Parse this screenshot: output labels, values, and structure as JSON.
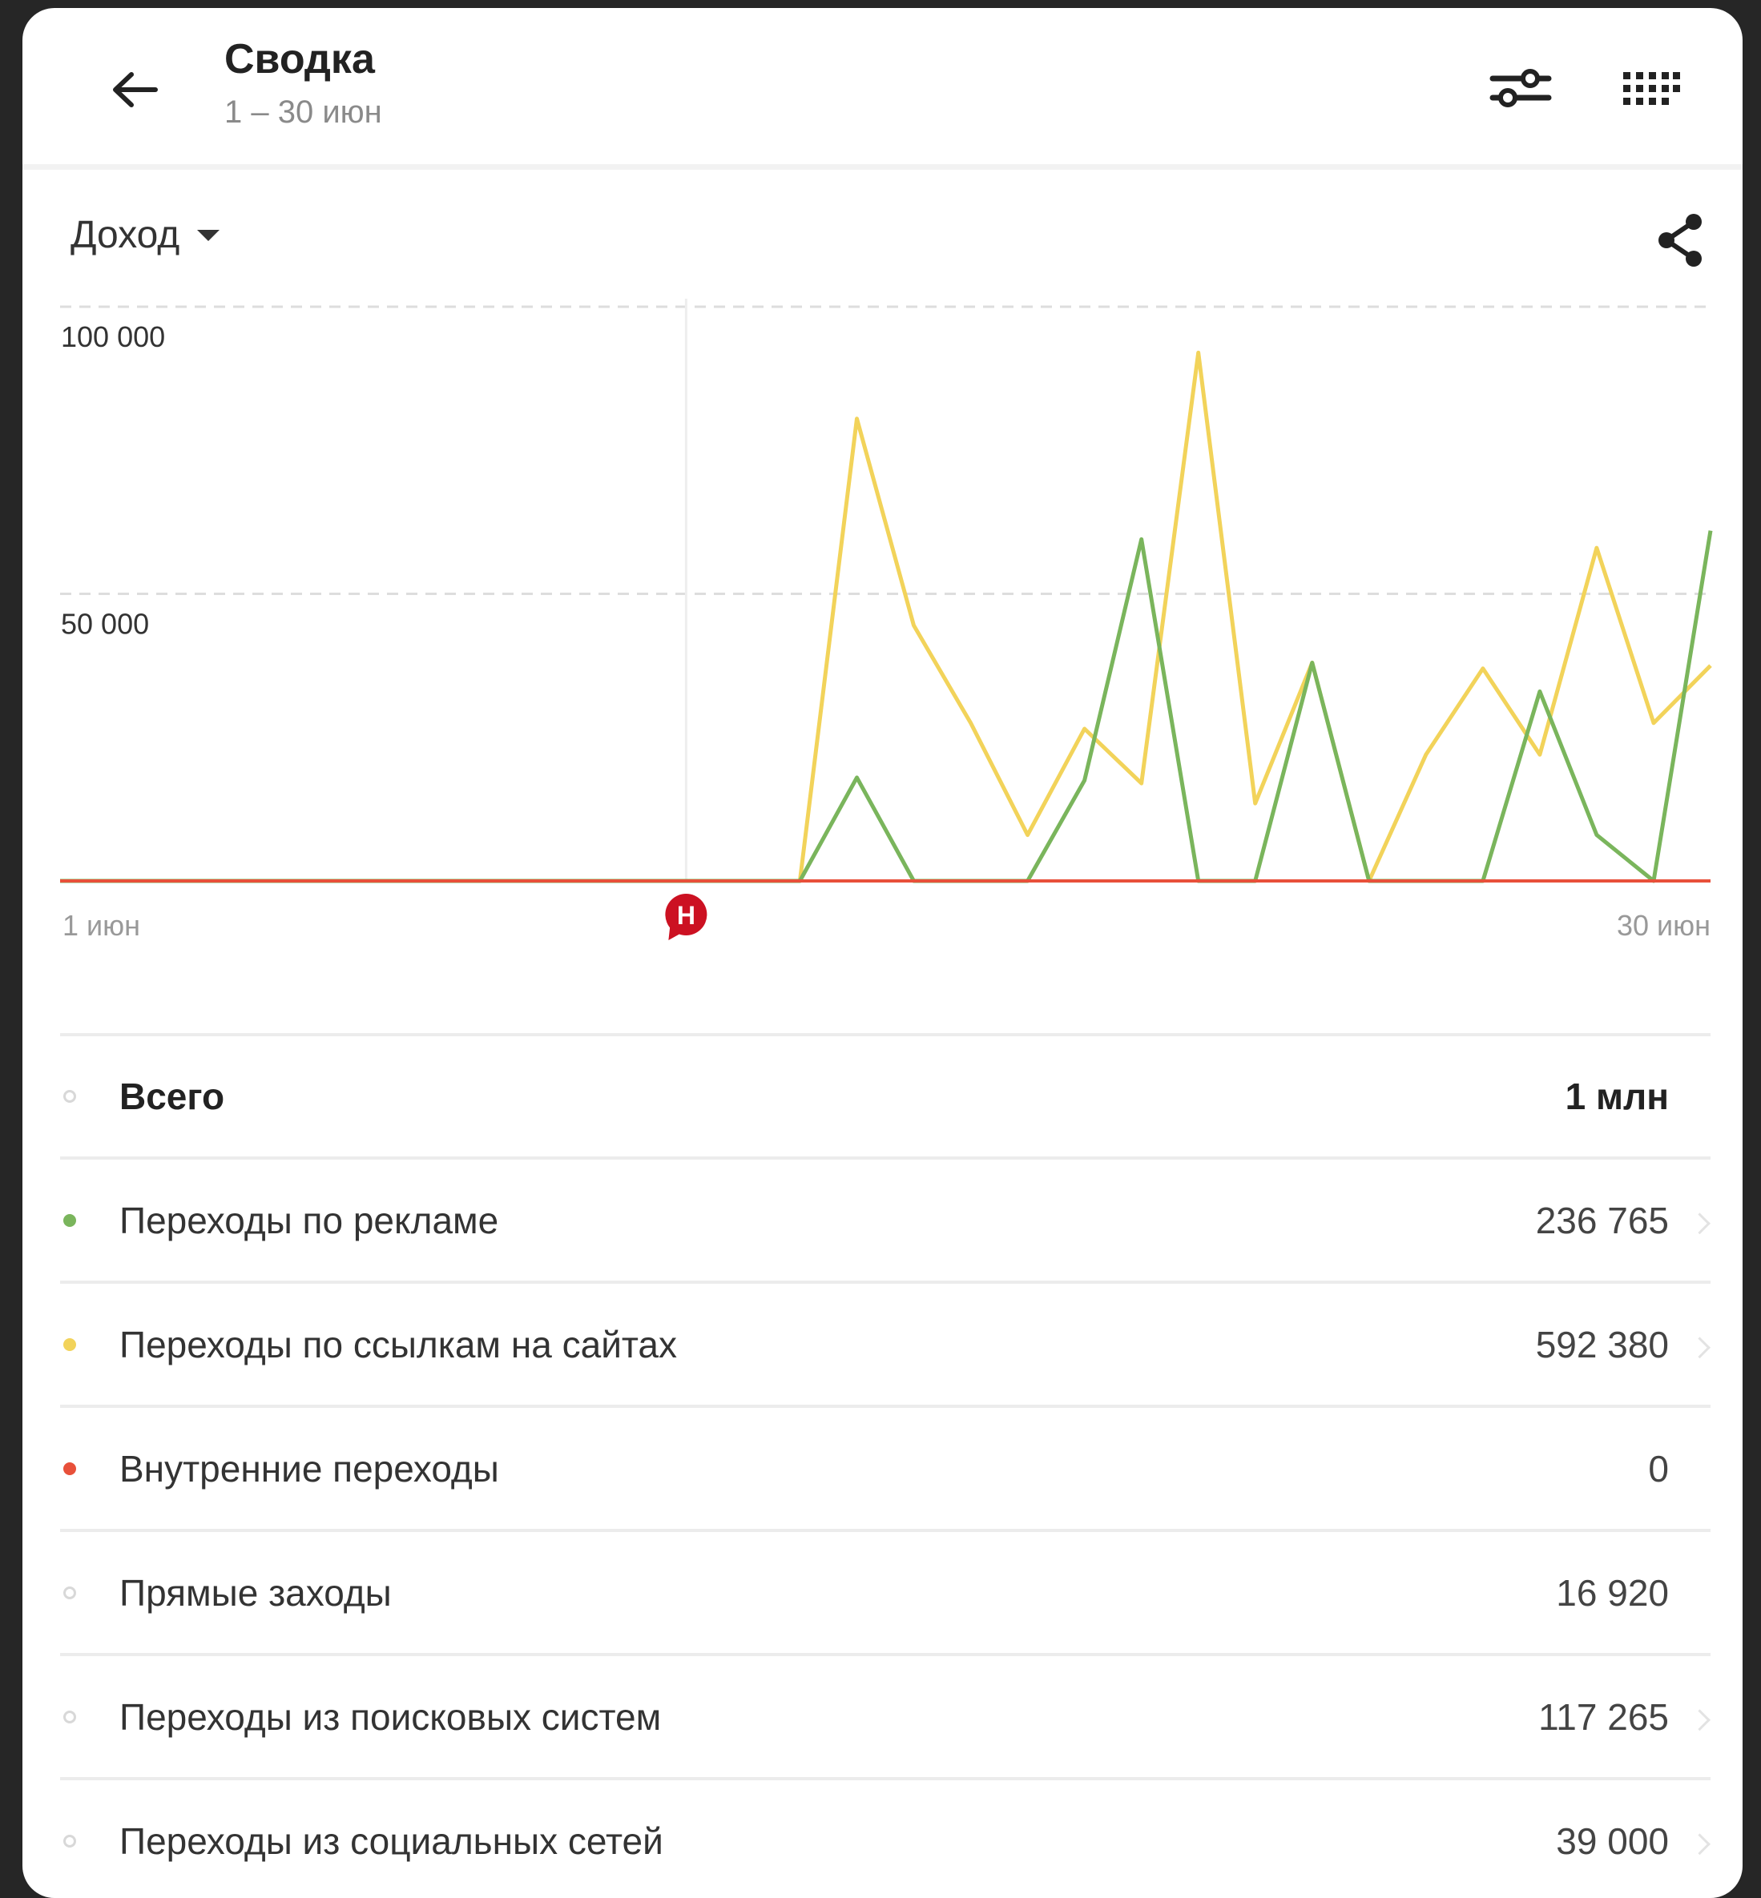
{
  "header": {
    "title": "Сводка",
    "subtitle": "1 – 30 июн",
    "icons": [
      "back-arrow-icon",
      "filter-sliders-icon",
      "grid-menu-icon"
    ]
  },
  "metric_selector": {
    "label": "Доход"
  },
  "share_icon": "share-icon",
  "chart_data": {
    "type": "line",
    "x": [
      "1 июн",
      "2 июн",
      "3 июн",
      "4 июн",
      "5 июн",
      "6 июн",
      "7 июн",
      "8 июн",
      "9 июн",
      "10 июн",
      "11 июн",
      "12 июн",
      "13 июн",
      "14 июн",
      "15 июн",
      "16 июн",
      "17 июн",
      "18 июн",
      "19 июн",
      "20 июн",
      "21 июн",
      "22 июн",
      "23 июн",
      "24 июн",
      "25 июн",
      "26 июн",
      "27 июн",
      "28 июн",
      "29 июн",
      "30 июн"
    ],
    "x_tick_labels": [
      "1 июн",
      "30 июн"
    ],
    "y_tick_labels": [
      "100 000",
      "50 000"
    ],
    "ylim": [
      0,
      100000
    ],
    "grid": true,
    "event_marker": {
      "label": "Н",
      "x": "12 июн",
      "color": "#cc1122"
    },
    "series": [
      {
        "color": "#f2d35a",
        "values": [
          0,
          0,
          0,
          0,
          0,
          0,
          0,
          0,
          0,
          0,
          0,
          0,
          0,
          0,
          80500,
          44500,
          27500,
          8000,
          26500,
          17000,
          92000,
          13500,
          38000,
          0,
          22000,
          37000,
          22000,
          58000,
          27500,
          37500
        ]
      },
      {
        "color": "#7ab55c",
        "values": [
          0,
          0,
          0,
          0,
          0,
          0,
          0,
          0,
          0,
          0,
          0,
          0,
          0,
          0,
          18000,
          0,
          0,
          0,
          17500,
          59500,
          0,
          0,
          38000,
          0,
          0,
          0,
          33000,
          8000,
          0,
          61000
        ]
      },
      {
        "color": "#e8503a",
        "values": [
          0,
          0,
          0,
          0,
          0,
          0,
          0,
          0,
          0,
          0,
          0,
          0,
          0,
          0,
          0,
          0,
          0,
          0,
          0,
          0,
          0,
          0,
          0,
          0,
          0,
          0,
          0,
          0,
          0,
          0
        ]
      }
    ]
  },
  "rows": [
    {
      "label": "Всего",
      "value": "1 млн",
      "dot": "hollow",
      "total": true,
      "chevron": false
    },
    {
      "label": "Переходы по рекламе",
      "value": "236 765",
      "dot": "#7ab55c",
      "chevron": true
    },
    {
      "label": "Переходы по ссылкам на сайтах",
      "value": "592 380",
      "dot": "#f2d35a",
      "chevron": true
    },
    {
      "label": "Внутренние переходы",
      "value": "0",
      "dot": "#e8503a",
      "chevron": false
    },
    {
      "label": "Прямые заходы",
      "value": "16 920",
      "dot": "hollow",
      "chevron": false
    },
    {
      "label": "Переходы из поисковых систем",
      "value": "117 265",
      "dot": "hollow",
      "chevron": true
    },
    {
      "label": "Переходы из социальных сетей",
      "value": "39 000",
      "dot": "hollow",
      "chevron": true
    }
  ]
}
